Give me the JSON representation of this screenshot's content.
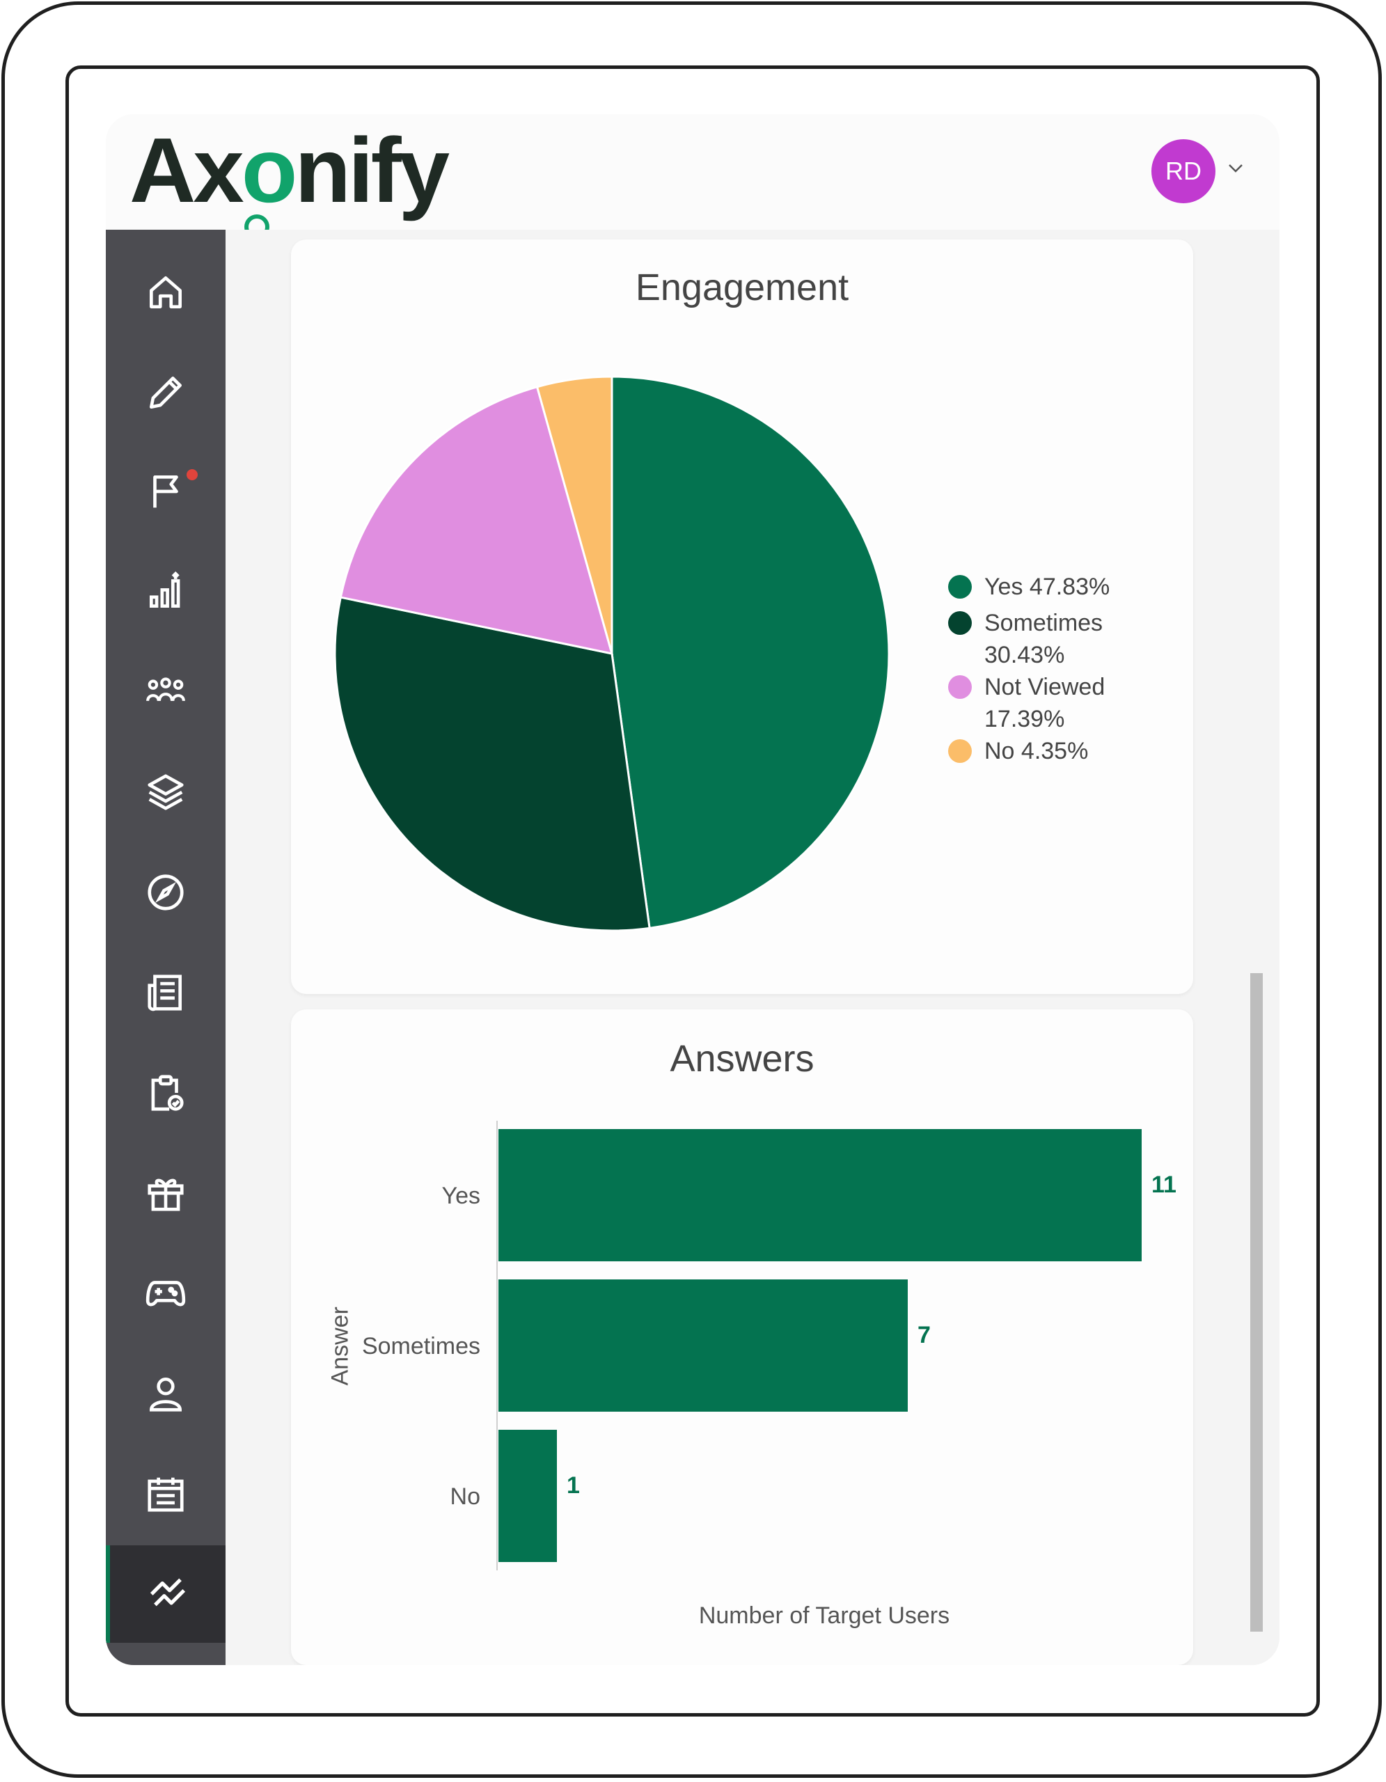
{
  "app": {
    "logo_text": "Axonify",
    "user_initials": "RD",
    "accent_color": "#0a7a52",
    "avatar_color": "#c13ad0"
  },
  "sidebar": {
    "items": [
      {
        "icon": "home-icon"
      },
      {
        "icon": "pencil-icon"
      },
      {
        "icon": "flag-icon",
        "has_notification": true
      },
      {
        "icon": "bar-chart-icon"
      },
      {
        "icon": "team-icon"
      },
      {
        "icon": "layers-icon"
      },
      {
        "icon": "compass-icon"
      },
      {
        "icon": "news-icon"
      },
      {
        "icon": "clipboard-check-icon"
      },
      {
        "icon": "gift-icon"
      },
      {
        "icon": "gamepad-icon"
      },
      {
        "icon": "user-icon"
      },
      {
        "icon": "calendar-icon"
      },
      {
        "icon": "analytics-icon",
        "active": true
      }
    ]
  },
  "engagement": {
    "title": "Engagement",
    "legend": [
      {
        "label_line1": "Yes 47.83%",
        "label_line2": ""
      },
      {
        "label_line1": "Sometimes",
        "label_line2": "30.43%"
      },
      {
        "label_line1": "Not Viewed",
        "label_line2": "17.39%"
      },
      {
        "label_line1": "No 4.35%",
        "label_line2": ""
      }
    ]
  },
  "answers": {
    "title": "Answers",
    "ylabel": "Answer",
    "xlabel": "Number of Target Users"
  },
  "chart_data": [
    {
      "type": "pie",
      "title": "Engagement",
      "categories": [
        "Yes",
        "Sometimes",
        "Not Viewed",
        "No"
      ],
      "values": [
        47.83,
        30.43,
        17.39,
        4.35
      ],
      "colors": [
        "#047350",
        "#04432f",
        "#e08ee0",
        "#fbbd69"
      ],
      "legend_placement": "right"
    },
    {
      "type": "bar",
      "orientation": "horizontal",
      "title": "Answers",
      "categories": [
        "Yes",
        "Sometimes",
        "No"
      ],
      "values": [
        11,
        7,
        1
      ],
      "xlabel": "Number of Target Users",
      "ylabel": "Answer",
      "color": "#047350",
      "xlim": [
        0,
        11
      ]
    }
  ]
}
